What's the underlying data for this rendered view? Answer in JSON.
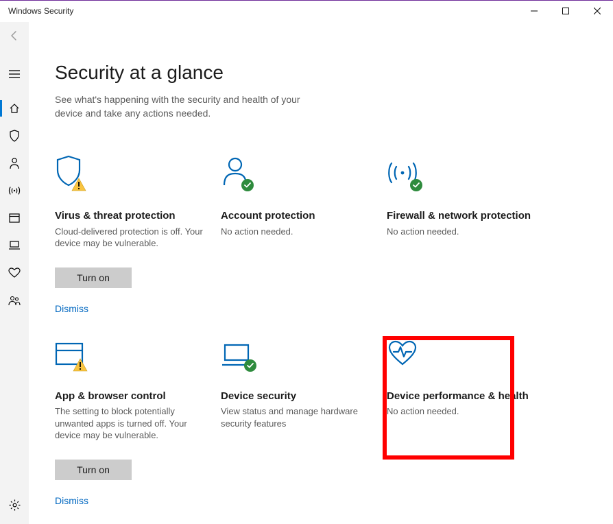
{
  "window": {
    "title": "Windows Security"
  },
  "nav": {
    "items": [
      {
        "name": "back-icon"
      },
      {
        "name": "hamburger-icon"
      },
      {
        "name": "home-icon",
        "selected": true
      },
      {
        "name": "shield-icon"
      },
      {
        "name": "person-icon"
      },
      {
        "name": "broadcast-icon"
      },
      {
        "name": "window-icon"
      },
      {
        "name": "laptop-icon"
      },
      {
        "name": "heart-icon"
      },
      {
        "name": "people-icon"
      }
    ],
    "footer": {
      "name": "settings-icon"
    }
  },
  "page": {
    "title": "Security at a glance",
    "subtitle": "See what's happening with the security and health of your device and take any actions needed."
  },
  "tiles": [
    {
      "icon": "shield-warning",
      "title": "Virus & threat protection",
      "desc": "Cloud-delivered protection is off. Your device may be vulnerable.",
      "action": "Turn on",
      "link": "Dismiss"
    },
    {
      "icon": "person-ok",
      "title": "Account protection",
      "desc": "No action needed."
    },
    {
      "icon": "broadcast-ok",
      "title": "Firewall & network protection",
      "desc": "No action needed."
    },
    {
      "icon": "window-warning",
      "title": "App & browser control",
      "desc": "The setting to block potentially unwanted apps is turned off. Your device may be vulnerable.",
      "action": "Turn on",
      "link": "Dismiss"
    },
    {
      "icon": "laptop-ok",
      "title": "Device security",
      "desc": "View status and manage hardware security features"
    },
    {
      "icon": "heart",
      "title": "Device performance & health",
      "desc": "No action needed."
    }
  ],
  "colors": {
    "accent": "#0078d4",
    "ok": "#2e8b3d",
    "warning": "#f9c440",
    "link": "#0067c0"
  }
}
